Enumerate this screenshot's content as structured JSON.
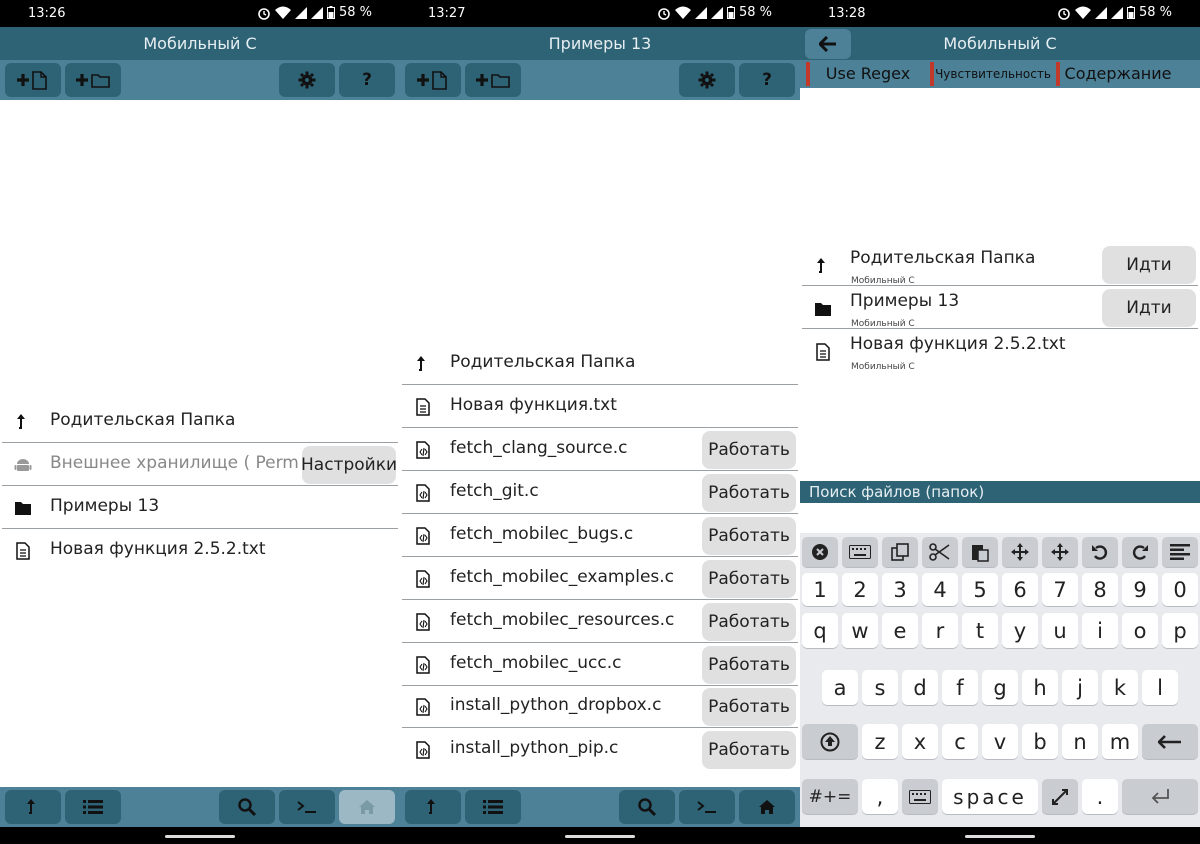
{
  "status": {
    "s1": {
      "time": "13:26",
      "battery": "58 %"
    },
    "s2": {
      "time": "13:27",
      "battery": "58 %"
    },
    "s3": {
      "time": "13:28",
      "battery": "58 %"
    }
  },
  "screen1": {
    "title": "Мобильный С",
    "rows": [
      {
        "label": "Родительская Папка",
        "icon": "parent-folder-icon"
      },
      {
        "label": "Внешнее хранилище ( Permissi",
        "icon": "android-icon",
        "action": "Настройки"
      },
      {
        "label": "Примеры 13",
        "icon": "folder-icon"
      },
      {
        "label": "Новая функция 2.5.2.txt",
        "icon": "text-file-icon"
      }
    ]
  },
  "screen2": {
    "title": "Примеры 13",
    "rows": [
      {
        "label": "Родительская Папка",
        "icon": "parent-folder-icon"
      },
      {
        "label": "Новая функция.txt",
        "icon": "text-file-icon"
      },
      {
        "label": "fetch_clang_source.c",
        "icon": "code-file-icon",
        "action": "Работать"
      },
      {
        "label": "fetch_git.c",
        "icon": "code-file-icon",
        "action": "Работать"
      },
      {
        "label": "fetch_mobilec_bugs.c",
        "icon": "code-file-icon",
        "action": "Работать"
      },
      {
        "label": "fetch_mobilec_examples.c",
        "icon": "code-file-icon",
        "action": "Работать"
      },
      {
        "label": "fetch_mobilec_resources.c",
        "icon": "code-file-icon",
        "action": "Работать"
      },
      {
        "label": "fetch_mobilec_ucc.c",
        "icon": "code-file-icon",
        "action": "Работать"
      },
      {
        "label": "install_python_dropbox.c",
        "icon": "code-file-icon",
        "action": "Работать"
      },
      {
        "label": "install_python_pip.c",
        "icon": "code-file-icon",
        "action": "Работать"
      }
    ]
  },
  "screen3": {
    "title": "Мобильный С",
    "filters": [
      "Use Regex",
      "Чувствительность",
      "Содержание"
    ],
    "rows": [
      {
        "label": "Родительская Папка",
        "sub": "Мобильный С",
        "icon": "parent-folder-icon",
        "action": "Идти"
      },
      {
        "label": "Примеры 13",
        "sub": "Мобильный С",
        "icon": "folder-icon",
        "action": "Идти"
      },
      {
        "label": "Новая функция 2.5.2.txt",
        "sub": "Мобильный С",
        "icon": "text-file-icon"
      }
    ],
    "search_label": "Поиск файлов (папок)",
    "keyboard": {
      "numbers": [
        "1",
        "2",
        "3",
        "4",
        "5",
        "6",
        "7",
        "8",
        "9",
        "0"
      ],
      "row1": [
        "q",
        "w",
        "e",
        "r",
        "t",
        "y",
        "u",
        "i",
        "o",
        "p"
      ],
      "row2": [
        "a",
        "s",
        "d",
        "f",
        "g",
        "h",
        "j",
        "k",
        "l"
      ],
      "row3": [
        "z",
        "x",
        "c",
        "v",
        "b",
        "n",
        "m"
      ],
      "symbols": "#+=",
      "comma": ",",
      "space": "space",
      "period": "."
    }
  },
  "toolbar": {
    "help": "?"
  },
  "colors": {
    "title_bg": "#2e6375",
    "bar_bg": "#4d8197",
    "button_bg": "#2e6375",
    "accent_red": "#c0392b"
  }
}
